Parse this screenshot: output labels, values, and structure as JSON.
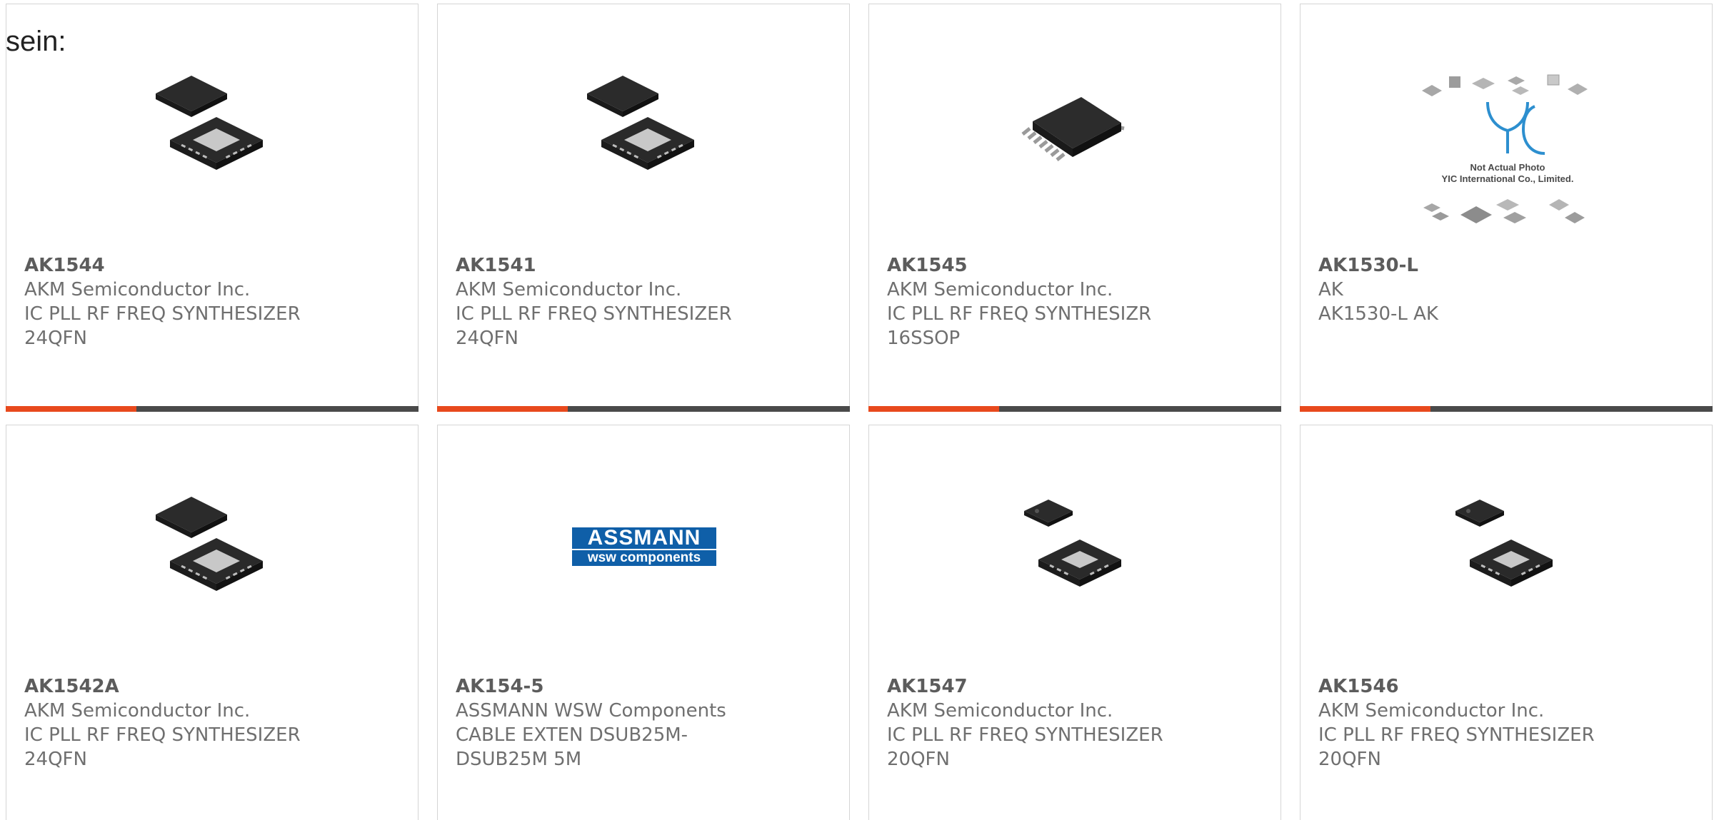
{
  "intro_text": "sein:",
  "accent_color": "#e8491d",
  "bar_color": "#4a4a4a",
  "products": [
    {
      "part": "AK1544",
      "manufacturer": "AKM Semiconductor Inc.",
      "desc1": "IC PLL RF FREQ SYNTHESIZER",
      "desc2": "24QFN",
      "image": "qfn-24-package-icon"
    },
    {
      "part": "AK1541",
      "manufacturer": "AKM Semiconductor Inc.",
      "desc1": "IC PLL RF FREQ SYNTHESIZER",
      "desc2": "24QFN",
      "image": "qfn-24-package-icon"
    },
    {
      "part": "AK1545",
      "manufacturer": "AKM Semiconductor Inc.",
      "desc1": "IC PLL RF FREQ SYNTHESIZR",
      "desc2": "16SSOP",
      "image": "ssop-16-package-icon"
    },
    {
      "part": "AK1530-L",
      "manufacturer": "AK",
      "desc1": "AK1530-L AK",
      "desc2": "",
      "image": "yic-placeholder-photo",
      "placeholder_line1": "Not Actual Photo",
      "placeholder_line2": "YIC International Co., Limited.",
      "placeholder_logo": "YIC"
    },
    {
      "part": "AK1542A",
      "manufacturer": "AKM Semiconductor Inc.",
      "desc1": "IC PLL RF FREQ SYNTHESIZER",
      "desc2": "24QFN",
      "image": "qfn-24-package-icon"
    },
    {
      "part": "AK154-5",
      "manufacturer": "ASSMANN WSW Components",
      "desc1": "CABLE EXTEN DSUB25M-",
      "desc2": "DSUB25M 5M",
      "image": "assmann-logo",
      "logo_top": "ASSMANN",
      "logo_bottom": "wsw components"
    },
    {
      "part": "AK1547",
      "manufacturer": "AKM Semiconductor Inc.",
      "desc1": "IC PLL RF FREQ SYNTHESIZER",
      "desc2": "20QFN",
      "image": "qfn-20-package-icon"
    },
    {
      "part": "AK1546",
      "manufacturer": "AKM Semiconductor Inc.",
      "desc1": "IC PLL RF FREQ SYNTHESIZER",
      "desc2": "20QFN",
      "image": "qfn-20-package-icon"
    }
  ]
}
